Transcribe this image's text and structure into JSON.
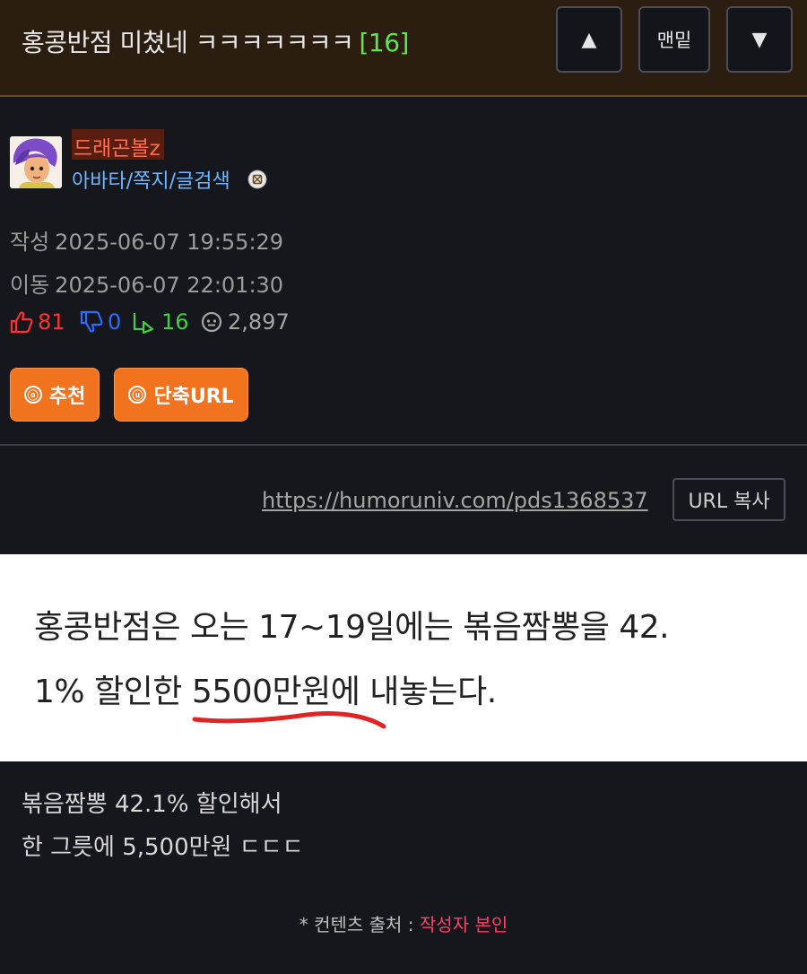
{
  "header": {
    "title": "홍콩반점 미쳤네 ㅋㅋㅋㅋㅋㅋㅋ",
    "comment_count": "[16]",
    "nav": {
      "up": "▲",
      "bottom": "맨밑",
      "down": "▼"
    }
  },
  "author": {
    "nickname": "드래곤볼z",
    "links": "아바타/쪽지/글검색"
  },
  "meta": {
    "created_label": "작성",
    "created": "2025-06-07 19:55:29",
    "moved_label": "이동",
    "moved": "2025-06-07 22:01:30"
  },
  "stats": {
    "upvotes": "81",
    "downvotes": "0",
    "replies": "16",
    "views": "2,897"
  },
  "actions": {
    "recommend_icon": "ⓞ",
    "recommend": "추천",
    "shorturl_icon": "ⓤ",
    "shorturl": "단축URL"
  },
  "share": {
    "url": "https://humoruniv.com/pds1368537",
    "copy": "URL 복사"
  },
  "image_text": {
    "line1": "홍콩반점은 오는 17~19일에는 볶음짬뽕을 42.",
    "line2": "1% 할인한 5500만원에 내놓는다."
  },
  "body": {
    "line1": "볶음짬뽕 42.1% 할인해서",
    "line2": "한 그릇에 5,500만원 ㄷㄷㄷ"
  },
  "source": {
    "prefix": "* 컨텐츠 출처 : ",
    "name": "작성자 본인"
  },
  "colors": {
    "header_bg": "#2b1e10",
    "page_bg": "#15171c",
    "accent_orange": "#f2731e",
    "nickname": "#ff6b50",
    "link_blue": "#6fb6ff",
    "count_green": "#5ee64a"
  }
}
